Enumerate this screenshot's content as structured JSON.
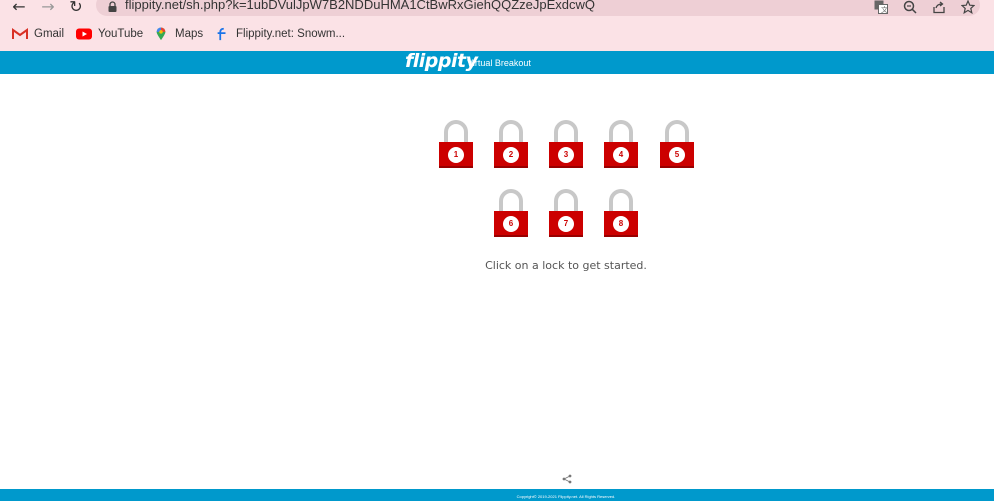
{
  "browser": {
    "url": "flippity.net/sh.php?k=1ubDVulJpW7B2NDDuHMA1CtBwRxGiehQQZzeJpExdcwQ",
    "nav_icons": [
      "back-arrow",
      "forward-arrow",
      "reload"
    ],
    "url_icons": [
      "translate",
      "zoom",
      "share",
      "star"
    ],
    "bookmarks": [
      {
        "label": "Gmail",
        "icon": "gmail-icon"
      },
      {
        "label": "YouTube",
        "icon": "youtube-icon"
      },
      {
        "label": "Maps",
        "icon": "maps-icon"
      },
      {
        "label": "Flippity.net: Snowm...",
        "icon": "flippity-icon"
      }
    ]
  },
  "header": {
    "logo": "flippity",
    "title": "Virtual Breakout",
    "background_color": "#0099cc"
  },
  "locks": [
    {
      "number": "1"
    },
    {
      "number": "2"
    },
    {
      "number": "3"
    },
    {
      "number": "4"
    },
    {
      "number": "5"
    },
    {
      "number": "6"
    },
    {
      "number": "7"
    },
    {
      "number": "8"
    }
  ],
  "lock_colors": {
    "body": "#cc0000",
    "shackle": "#c8c8c8"
  },
  "instructions": "Click on a lock to get started.",
  "footer": {
    "copyright": "Copyright© 2019-2021 Flippity.net. All Rights Reserved."
  }
}
